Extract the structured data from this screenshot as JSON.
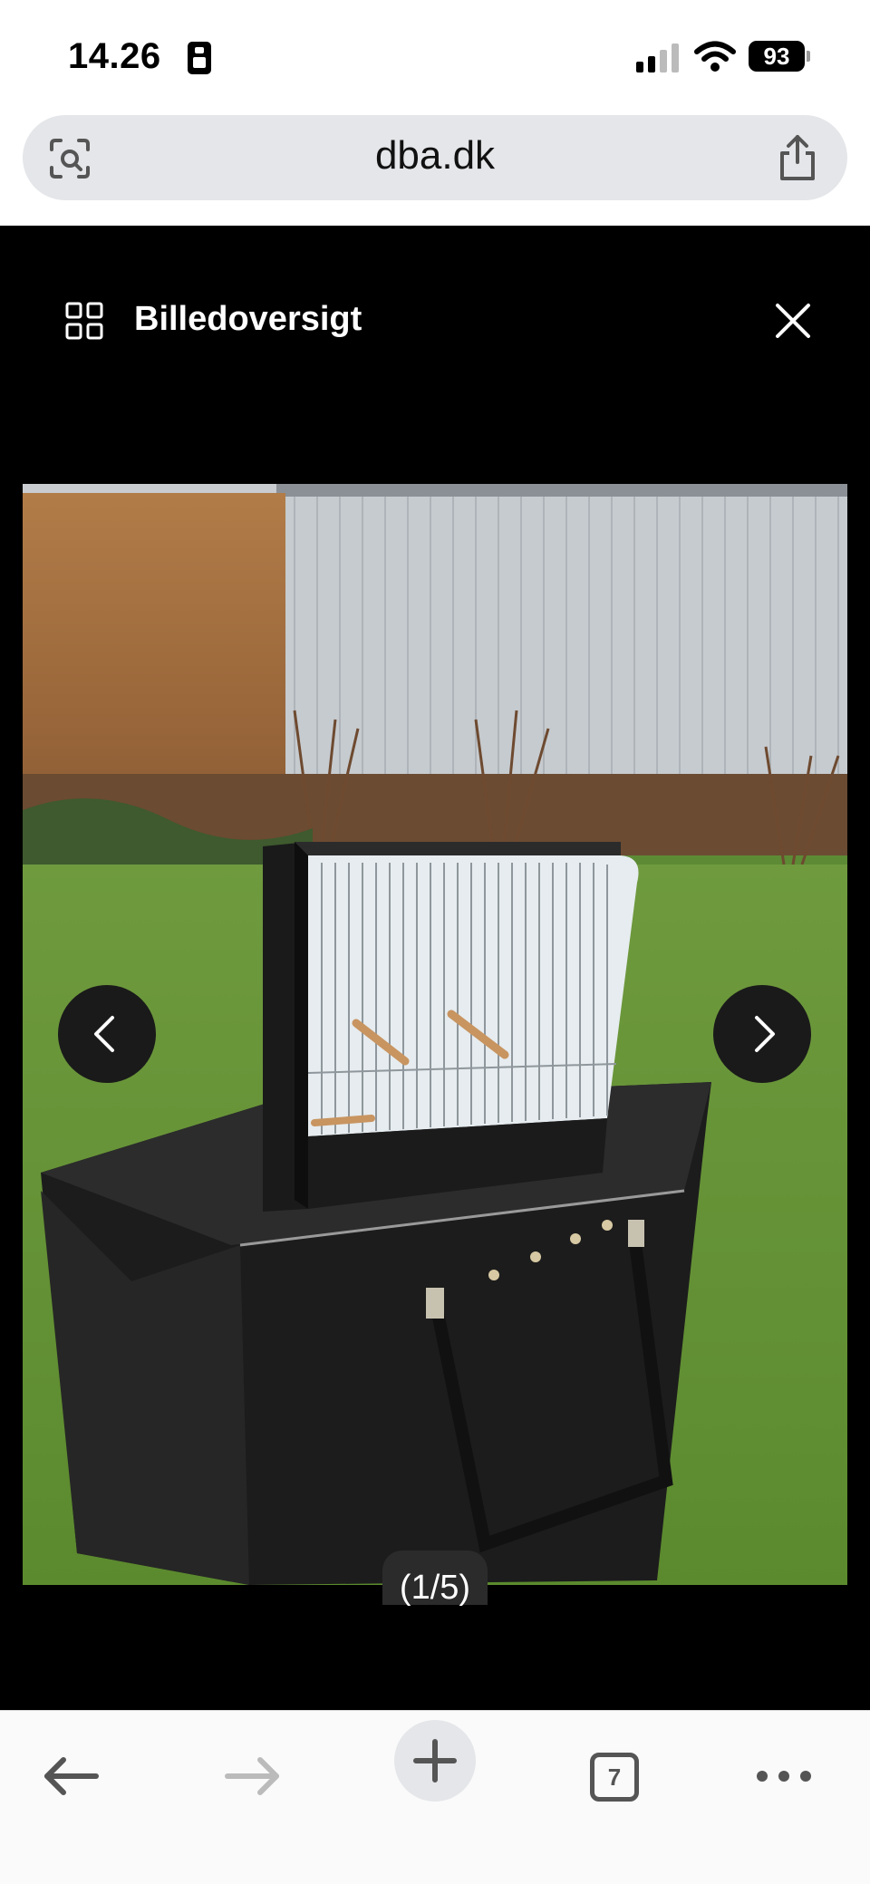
{
  "status_bar": {
    "time": "14.26",
    "battery": "93"
  },
  "url_bar": {
    "url": "dba.dk",
    "left_icon": "lens-icon",
    "right_icon": "share-icon"
  },
  "viewer": {
    "title": "Billedoversigt",
    "counter": "(1/5)",
    "image_current": 1,
    "image_total": 5,
    "image_alt": "Bird transport cage on a black carry bag on the lawn"
  },
  "toolbar": {
    "tabs_count": "7"
  },
  "colors": {
    "viewer_bg": "#000000",
    "url_bar_bg": "#e4e6e9",
    "toolbar_bg": "#fafafa"
  }
}
